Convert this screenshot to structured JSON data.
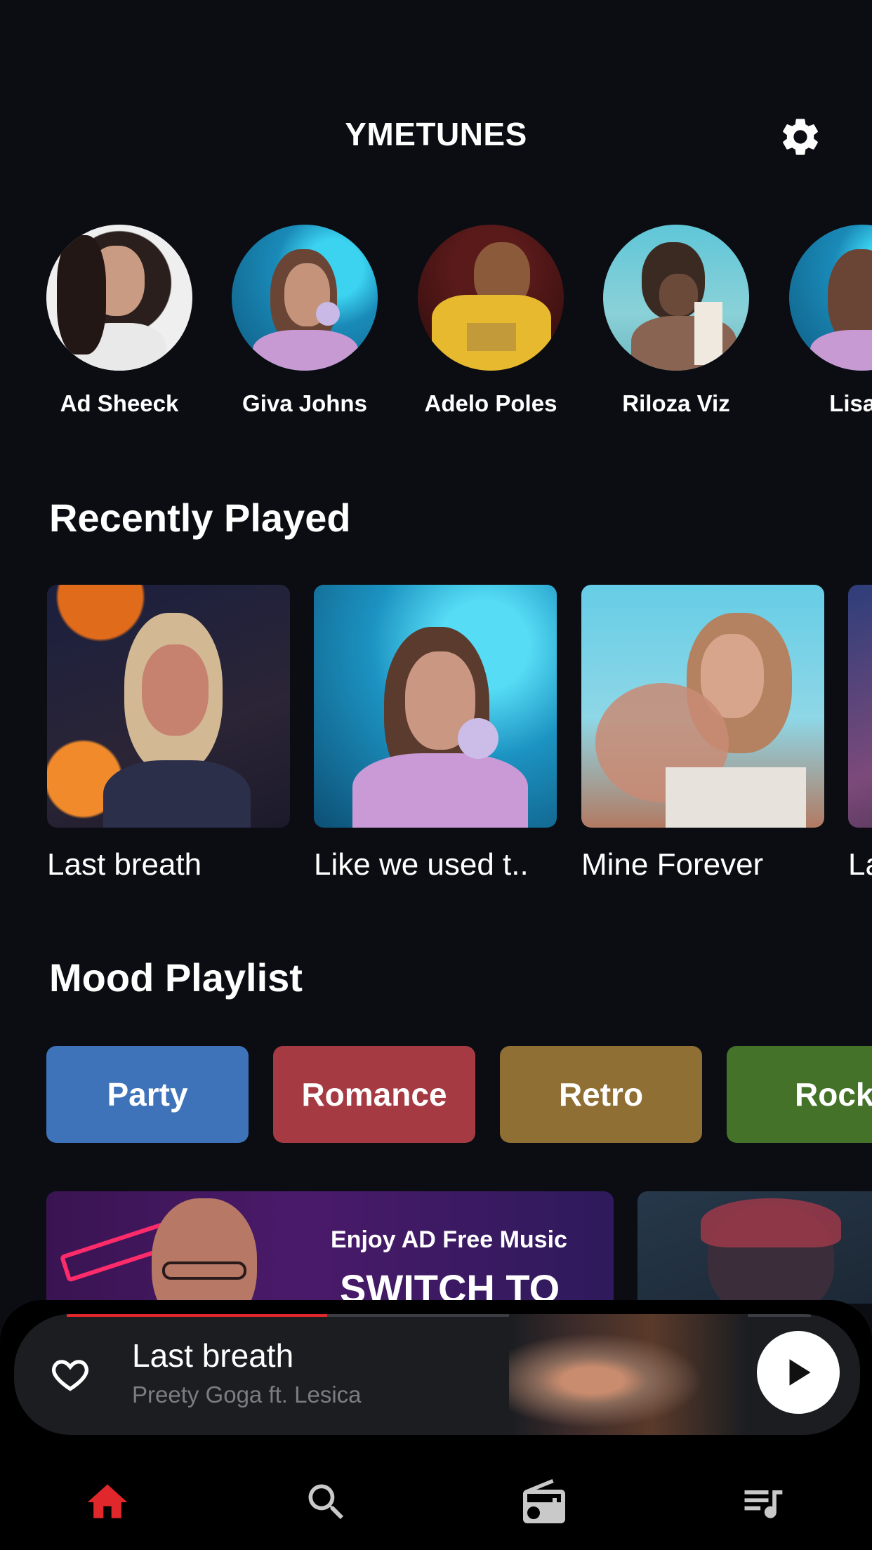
{
  "header": {
    "title": "YMETUNES",
    "settings_icon": "gear-icon"
  },
  "artists": [
    {
      "name": "Ad Sheeck"
    },
    {
      "name": "Giva Johns"
    },
    {
      "name": "Adelo Poles"
    },
    {
      "name": "Riloza Viz"
    },
    {
      "name": "Lisavi"
    }
  ],
  "recently_played": {
    "title": "Recently Played",
    "items": [
      {
        "label": "Last breath"
      },
      {
        "label": "Like we used t.."
      },
      {
        "label": "Mine Forever"
      },
      {
        "label": "La"
      }
    ]
  },
  "mood_playlist": {
    "title": "Mood Playlist",
    "items": [
      {
        "label": "Party",
        "color": "#3e72b9"
      },
      {
        "label": "Romance",
        "color": "#a63a43"
      },
      {
        "label": "Retro",
        "color": "#8f6f33"
      },
      {
        "label": "Rock",
        "color": "#447229"
      }
    ]
  },
  "promo": {
    "line1": "Enjoy AD Free Music",
    "line2": "SWITCH TO"
  },
  "player": {
    "title": "Last breath",
    "artist": "Preety Goga ft. Lesica",
    "progress": 0.35,
    "favorite_icon": "heart-outline-icon",
    "play_icon": "play-icon"
  },
  "nav": [
    {
      "name": "home",
      "icon": "home-icon",
      "active": true
    },
    {
      "name": "search",
      "icon": "search-icon",
      "active": false
    },
    {
      "name": "radio",
      "icon": "radio-icon",
      "active": false
    },
    {
      "name": "queue",
      "icon": "playlist-icon",
      "active": false
    }
  ],
  "colors": {
    "accent": "#e0272b",
    "background": "#0b0d12"
  }
}
